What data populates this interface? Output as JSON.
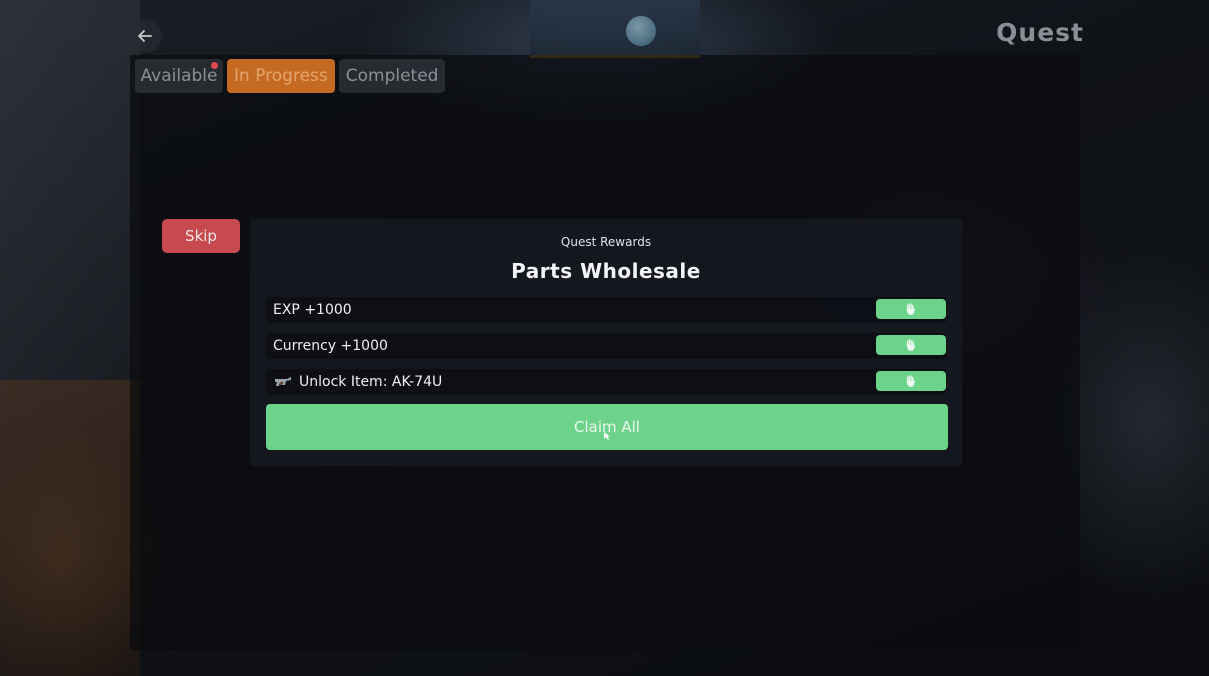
{
  "header": {
    "back_icon": "arrow-left-icon",
    "title": "Quest"
  },
  "tabs": [
    {
      "label": "Available",
      "active": false,
      "has_notification": true
    },
    {
      "label": "In Progress",
      "active": true,
      "has_notification": false
    },
    {
      "label": "Completed",
      "active": false,
      "has_notification": false
    }
  ],
  "skip_label": "Skip",
  "rewards": {
    "subtitle": "Quest Rewards",
    "title": "Parts Wholesale",
    "items": [
      {
        "label": "EXP +1000",
        "icon": null,
        "claim_icon": "hand-icon"
      },
      {
        "label": "Currency +1000",
        "icon": null,
        "claim_icon": "hand-icon"
      },
      {
        "label": "Unlock Item: AK-74U",
        "icon": "rifle-icon",
        "claim_icon": "hand-icon"
      }
    ],
    "claim_all_label": "Claim All"
  },
  "colors": {
    "accent_green": "#6ed38a",
    "tab_active": "#c46a22",
    "skip_red": "#c74a4f",
    "notification_red": "#e24b4b"
  }
}
